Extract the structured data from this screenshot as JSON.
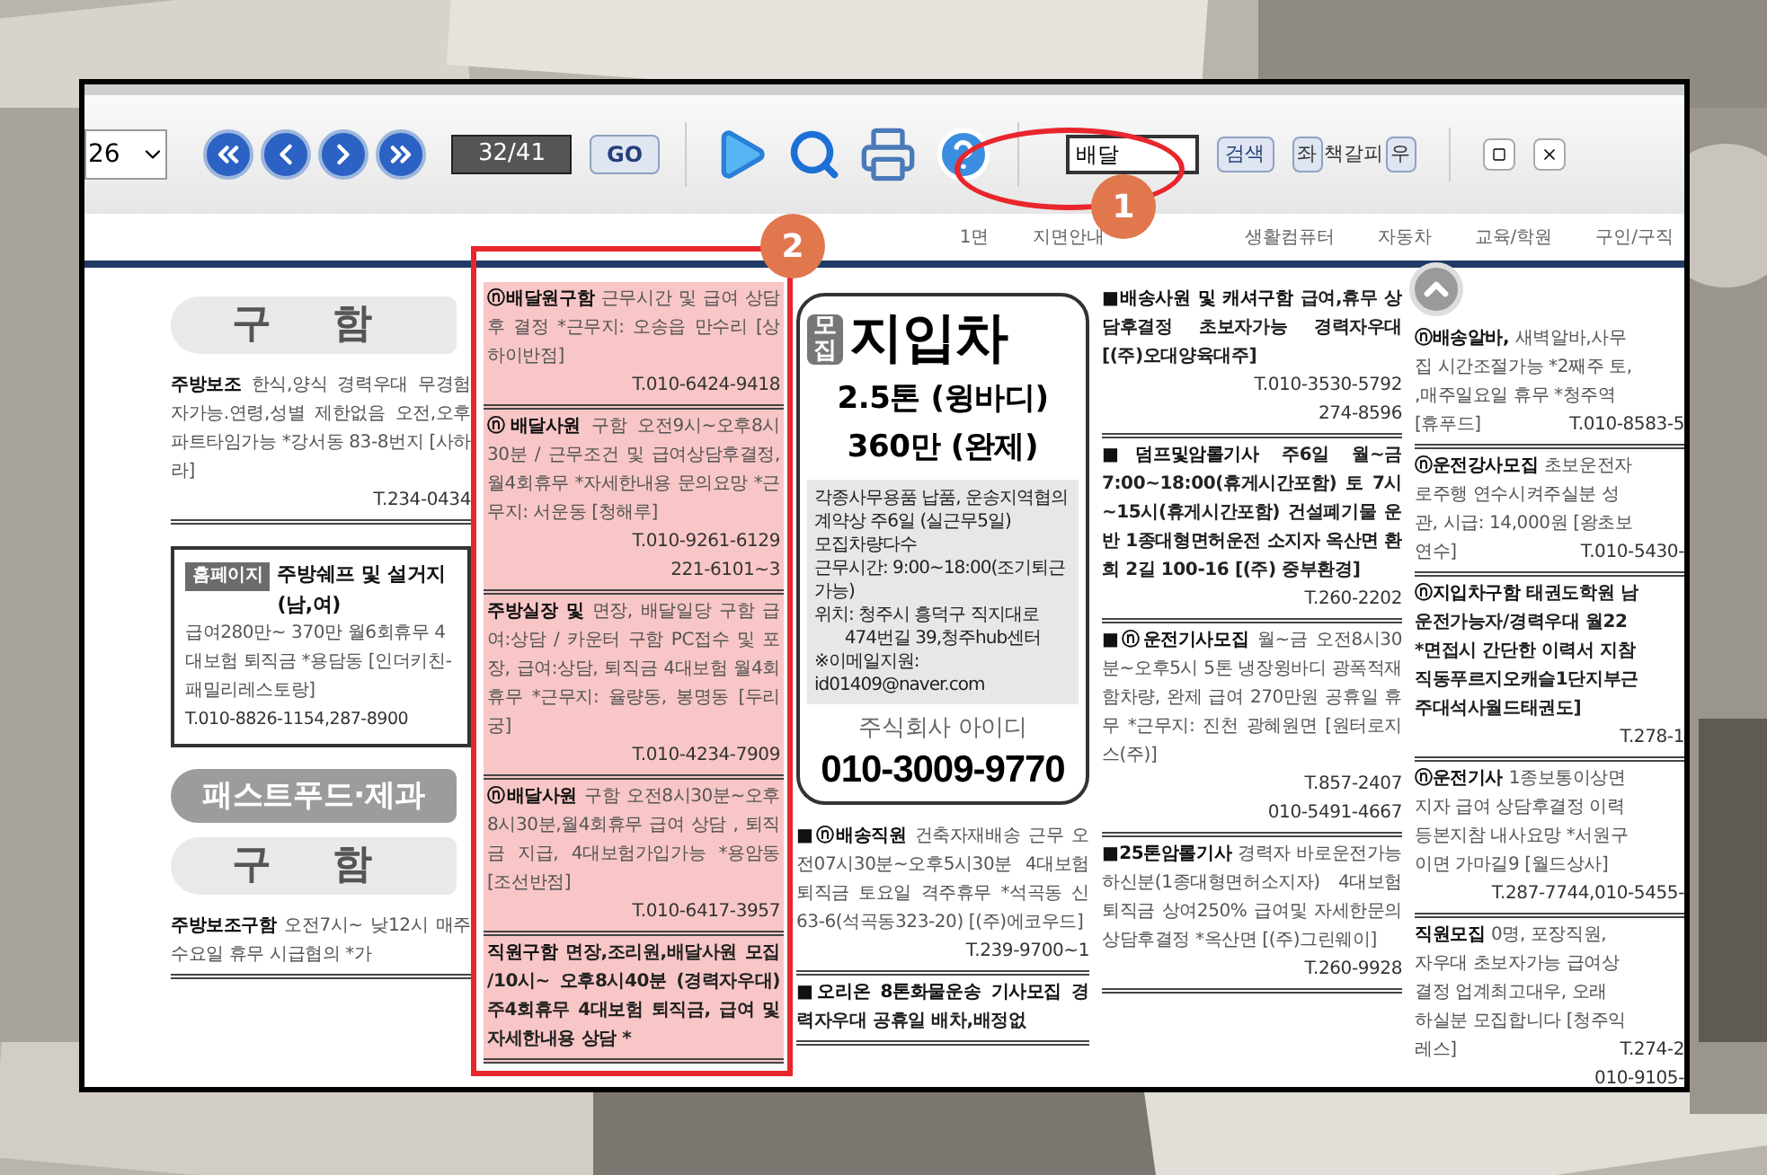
{
  "toolbar": {
    "page_select": "26",
    "page_counter": "32/41",
    "go_button": "GO",
    "search_value": "배달",
    "search_button": "검색",
    "left_button": "좌",
    "bookmark_button": "책갈피",
    "right_button": "우"
  },
  "section_nav": [
    "1면",
    "지면안내",
    "생활컴퓨터",
    "자동차",
    "교육/학원",
    "구인/구직"
  ],
  "columns": [
    {
      "blocks": [
        {
          "kind": "heading",
          "text": "구 함"
        },
        {
          "kind": "listing",
          "title": "주방보조",
          "body": " 한식,양식 경력우대 무경험자가능.연령,성별 제한없음 오전,오후 파트타임가능 *강서동 83-8번지 [사하라]",
          "phones": [
            "T.234-0434"
          ],
          "highlighted": false,
          "bold": false
        },
        {
          "kind": "homepage",
          "tag": "홈페이지",
          "title": "주방쉐프 및 설거지(남,여)",
          "body": "급여280만~ 370만 월6회휴무 4대보험 퇴직금 *용담동 [인더키친- 패밀리레스토랑]",
          "phones": [
            "T.010-8826-1154,287-8900"
          ]
        },
        {
          "kind": "banner",
          "text": "패스트푸드·제과"
        },
        {
          "kind": "heading",
          "text": "구 함"
        },
        {
          "kind": "listing",
          "title": "주방보조구함",
          "body": " 오전7시~ 낮12시 매주 수요일 휴무 시급협의 *가",
          "highlighted": false,
          "bold": false
        }
      ]
    },
    {
      "blocks": [
        {
          "kind": "listing",
          "title": "ⓝ배달원구함",
          "body": " 근무시간 및 급여 상담후 결정 *근무지: 오송읍 만수리 [상하이반점]",
          "phones": [
            "T.010-6424-9418"
          ],
          "highlighted": true,
          "bold": false
        },
        {
          "kind": "listing",
          "title": "ⓝ배달사원",
          "body": " 구함 오전9시~오후8시30분 / 근무조건 및 급여상담후결정, 월4회휴무 *자세한내용 문의요망 *근무지: 서운동 [청해루]",
          "phones": [
            "T.010-9261-6129",
            "221-6101~3"
          ],
          "highlighted": true,
          "bold": false
        },
        {
          "kind": "listing",
          "title": "주방실장 및",
          "body": " 면장, 배달일당 구함 급여:상담 / 카운터 구함 PC접수 및 포장, 급여:상담, 퇴직금 4대보험 월4회휴무 *근무지: 율량동, 봉명동 [두리궁]",
          "phones": [
            "T.010-4234-7909"
          ],
          "highlighted": true,
          "bold": false
        },
        {
          "kind": "listing",
          "title": "ⓝ배달사원",
          "body": " 구함 오전8시30분~오후8시30분,월4회휴무 급여 상담 , 퇴직금 지급, 4대보험가입가능 *용암동 [조선반점]",
          "phones": [
            "T.010-6417-3957"
          ],
          "highlighted": true,
          "bold": false
        },
        {
          "kind": "listing",
          "title": "직원구함",
          "body": " 면장,조리원,배달사원 모집 /10시~ 오후8시40분 (경력자우대) 주4회휴무 4대보험 퇴직금, 급여 및 자세한내용 상담 *",
          "highlighted": true,
          "bold": true
        }
      ]
    },
    {
      "blocks": [
        {
          "kind": "ad",
          "tag": "모집",
          "title": "지입차",
          "lines": [
            "2.5톤 (윙바디)",
            "360만 (완제)"
          ],
          "bullets": [
            "각종사무용품 납품, 운송지역협의",
            "계약상 주6일 (실근무5일)",
            "모집차량다수",
            "근무시간: 9:00~18:00(조기퇴근가능)",
            "위치: 청주시 흥덕구 직지대로"
          ],
          "bullet_continuation": "474번길 39,청주hub센터",
          "email": "※이메일지원: id01409@naver.com",
          "company": "주식회사 아이디",
          "phone": "010-3009-9770"
        },
        {
          "kind": "listing",
          "title": "■ⓝ배송직원",
          "body": " 건축자재배송 근무 오전07시30분~오후5시30분 4대보험 퇴직금 토요일 격주휴무 *석곡동 신63-6(석곡동323-20) [(주)에코우드]",
          "phones": [
            "T.239-9700~1"
          ],
          "highlighted": false,
          "bold": false
        },
        {
          "kind": "listing",
          "title": "■오리온 8톤화물운송 기사모집",
          "body": " 경력자우대 공휴일 배차,배정없",
          "highlighted": false,
          "bold": true
        }
      ]
    },
    {
      "blocks": [
        {
          "kind": "listing",
          "title": "■배송사원 및 캐셔구함",
          "body": " 급여,휴무 상담후결정 초보자가능 경력자우대 [(주)오대양육대주]",
          "phones": [
            "T.010-3530-5792",
            "274-8596"
          ],
          "highlighted": false,
          "bold": true
        },
        {
          "kind": "listing",
          "title": "■덤프및암롤기사",
          "body": " 주6일 월~금 7:00~18:00(휴게시간포함) 토 7시~15시(휴게시간포함) 건설폐기물 운반 1종대형면허운전 소지자 옥산면 환희 2길 100-16 [(주) 중부환경]",
          "phones": [
            "T.260-2202"
          ],
          "highlighted": false,
          "bold": true
        },
        {
          "kind": "listing",
          "title": "■ⓝ운전기사모집",
          "body": " 월~금 오전8시30분~오후5시 5톤 냉장윙바디 광폭적재함차량, 완제 급여 270만원 공휴일 휴무 *근무지: 진천 광혜원면 [원터로지스(주)]",
          "phones": [
            "T.857-2407",
            "010-5491-4667"
          ],
          "highlighted": false,
          "bold": false
        },
        {
          "kind": "listing",
          "title": "■25톤암롤기사",
          "body": " 경력자 바로운전가능하신분(1종대형면허소지자) 4대보험 퇴직금 상여250% 급여및 자세한문의 상담후결정 *옥산면 [(주)그린웨이]",
          "phones": [
            "T.260-9928"
          ],
          "highlighted": false,
          "bold": false
        }
      ]
    },
    {
      "blocks": [
        {
          "kind": "cut_listing",
          "title": "ⓝ배송알바,",
          "lines": [
            "새벽알바,사무",
            "집 시간조절가능 *2째주 토,",
            ",매주일요일 휴무 *청주역"
          ],
          "tail": "[휴푸드]",
          "phones": [
            "T.010-8583-5"
          ],
          "bold": false
        },
        {
          "kind": "cut_listing",
          "title": "ⓝ운전강사모집",
          "lines": [
            "초보운전자",
            "로주행 연수시켜주실분 성",
            "관, 시급: 14,000원 [왕초보"
          ],
          "tail": "연수]",
          "phones": [
            "T.010-5430-"
          ],
          "bold": false
        },
        {
          "kind": "cut_listing",
          "title": "ⓝ지입차구함",
          "lines": [
            "태권도학원 남",
            "운전가능자/경력우대 월22",
            "*면접시 간단한 이력서 지참",
            "직동푸르지오캐슬1단지부근",
            "주대석사월드태권도]"
          ],
          "phones": [
            "T.278-1"
          ],
          "bold": true
        },
        {
          "kind": "cut_listing",
          "title": "ⓝ운전기사",
          "lines": [
            "1종보통이상면",
            "지자 급여 상담후결정 이력",
            "등본지참 내사요망 *서원구",
            "이면 가마길9 [월드상사]"
          ],
          "phones": [
            "T.287-7744,010-5455-"
          ],
          "bold": false
        },
        {
          "kind": "cut_listing",
          "title": "직원모집",
          "lines": [
            "0명, 포장직원,",
            "자우대 초보자가능 급여상",
            "결정 업계최고대우, 오래",
            "하실분 모집합니다 [청주익"
          ],
          "tail": "레스]",
          "phones": [
            "T.274-2",
            "010-9105-"
          ],
          "bold": false
        }
      ]
    }
  ],
  "annotations": [
    {
      "label": "1"
    },
    {
      "label": "2"
    }
  ]
}
